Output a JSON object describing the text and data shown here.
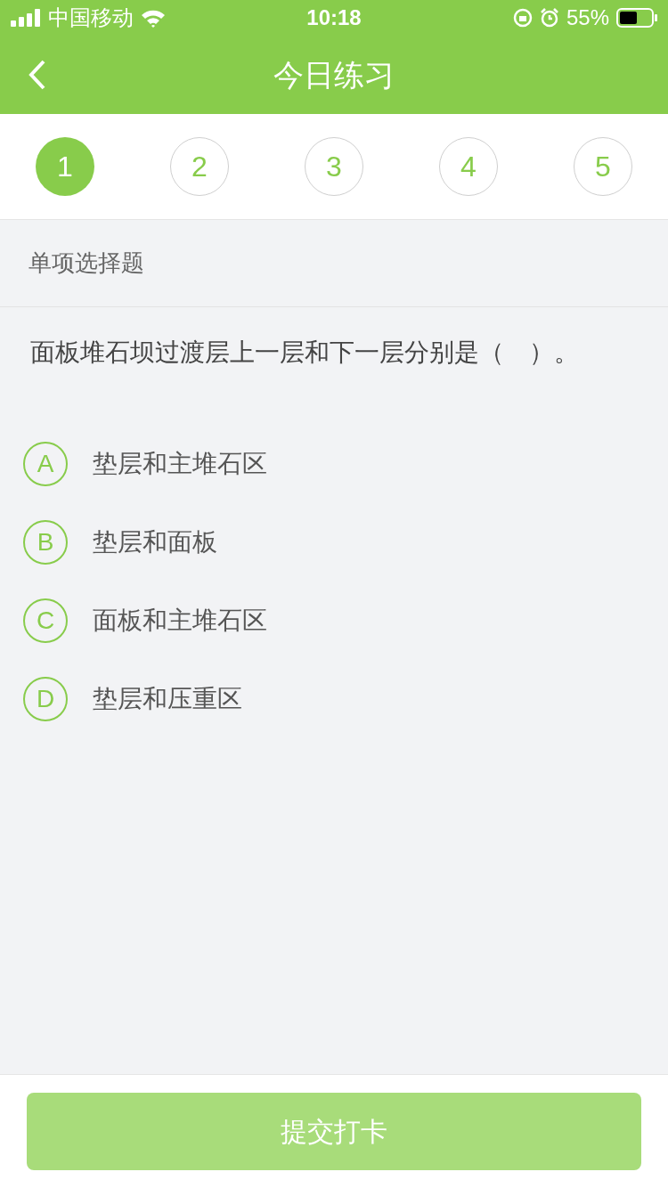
{
  "status_bar": {
    "carrier": "中国移动",
    "time": "10:18",
    "battery": "55%"
  },
  "header": {
    "title": "今日练习"
  },
  "steps": [
    {
      "label": "1",
      "selected": true
    },
    {
      "label": "2",
      "selected": false
    },
    {
      "label": "3",
      "selected": false
    },
    {
      "label": "4",
      "selected": false
    },
    {
      "label": "5",
      "selected": false
    }
  ],
  "section": {
    "title": "单项选择题"
  },
  "question": "面板堆石坝过渡层上一层和下一层分别是（　）。",
  "options": [
    {
      "letter": "A",
      "text": "垫层和主堆石区",
      "selected": false
    },
    {
      "letter": "B",
      "text": "垫层和面板",
      "selected": false
    },
    {
      "letter": "C",
      "text": "面板和主堆石区",
      "selected": false
    },
    {
      "letter": "D",
      "text": "垫层和压重区",
      "selected": false
    }
  ],
  "submit": {
    "label": "提交打卡",
    "disabled": true
  }
}
